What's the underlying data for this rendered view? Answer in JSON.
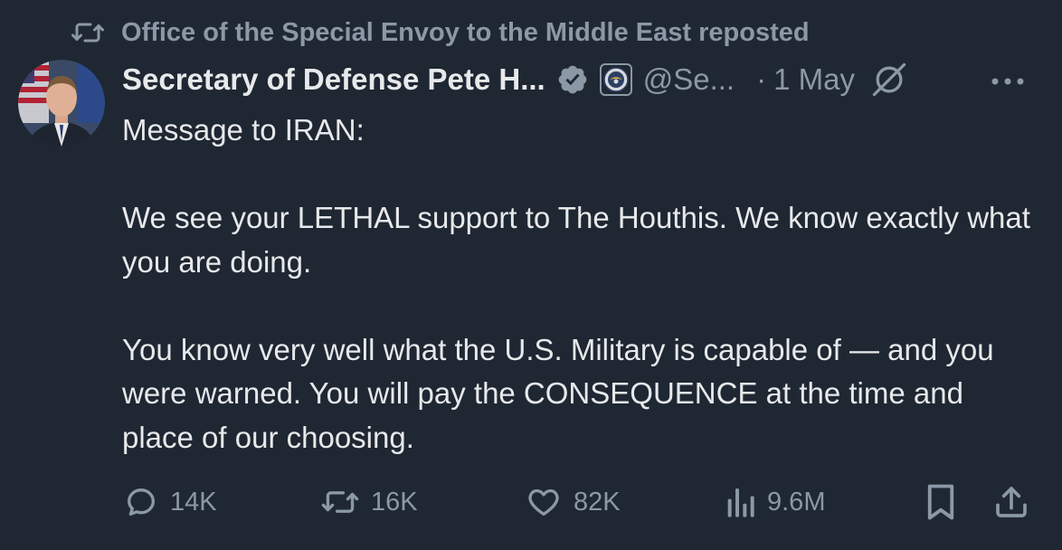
{
  "repost": {
    "text": "Office of the Special Envoy to the Middle East reposted",
    "icon": "repost-icon"
  },
  "author": {
    "display_name": "Secretary of Defense Pete H...",
    "handle": "@Se...",
    "separator": "·",
    "time": "1 May",
    "verified_icon": "verified-badge-icon",
    "affiliation_icon": "dod-seal-icon"
  },
  "tweet": {
    "paragraphs": [
      "Message to IRAN:",
      "We see your LETHAL support to The Houthis. We know exactly what you are doing.",
      "You know very well what the U.S. Military is capable of — and you were warned. You will pay the CONSEQUENCE at the time and place of our choosing."
    ]
  },
  "actions": {
    "replies": "14K",
    "reposts": "16K",
    "likes": "82K",
    "views": "9.6M"
  },
  "colors": {
    "background": "#1f2733",
    "text": "#e7e9ea",
    "muted": "#8b98a5",
    "verified": "#8b98a5"
  }
}
